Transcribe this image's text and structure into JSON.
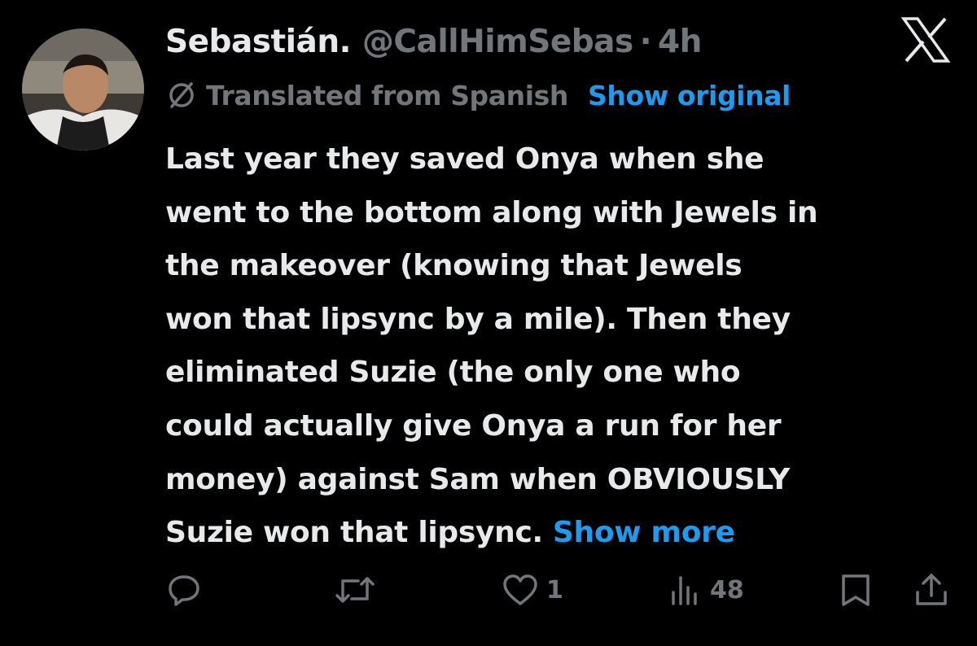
{
  "tweet": {
    "display_name": "Sebastián.",
    "handle": "@CallHimSebas",
    "separator": "·",
    "timestamp": "4h",
    "translation": {
      "notice": "Translated from Spanish",
      "show_original": "Show original"
    },
    "text_lines": [
      "Last year they saved Onya when she",
      "went to the bottom along with Jewels in",
      "the makeover (knowing that Jewels",
      "won that lipsync by a mile). Then they",
      "eliminated Suzie (the only one who",
      "could actually give Onya a run for her",
      "money) against Sam when OBVIOUSLY",
      "Suzie won that lipsync."
    ],
    "show_more": "Show more"
  },
  "actions": {
    "reply": {
      "icon": "reply-icon",
      "count": ""
    },
    "retweet": {
      "icon": "retweet-icon",
      "count": ""
    },
    "like": {
      "icon": "heart-icon",
      "count": "1"
    },
    "views": {
      "icon": "views-icon",
      "count": "48"
    },
    "bookmark": {
      "icon": "bookmark-icon"
    },
    "share": {
      "icon": "share-icon"
    }
  },
  "colors": {
    "background": "#000000",
    "primary_text": "#e7e9ea",
    "secondary_text": "#71767b",
    "link": "#1d9bf0"
  }
}
